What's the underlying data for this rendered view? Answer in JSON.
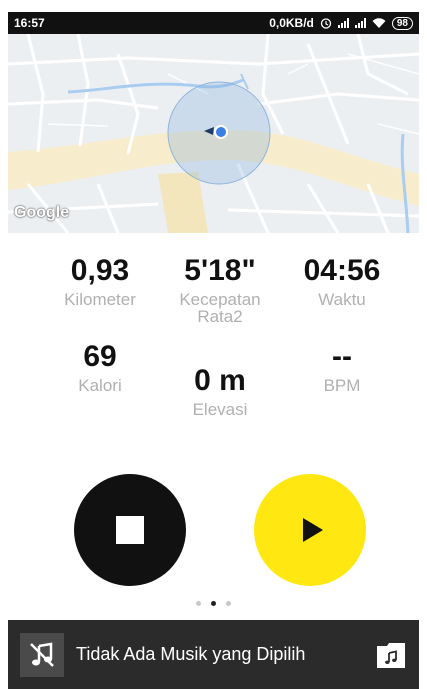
{
  "status_bar": {
    "time": "16:57",
    "network_speed": "0,0KB/d",
    "battery": "98",
    "network_type": "4G"
  },
  "map": {
    "attribution": "Google"
  },
  "stats": {
    "distance": {
      "value": "0,93",
      "label": "Kilometer"
    },
    "pace": {
      "value": "5'18\"",
      "label_line1": "Kecepatan",
      "label_line2": "Rata2"
    },
    "time": {
      "value": "04:56",
      "label": "Waktu"
    },
    "calories": {
      "value": "69",
      "label": "Kalori"
    },
    "elevation": {
      "value": "0 m",
      "label": "Elevasi"
    },
    "heart_rate": {
      "value": "--",
      "label": "BPM"
    }
  },
  "controls": {
    "stop_icon": "stop-icon",
    "play_icon": "play-icon",
    "stop_color": "#111111",
    "play_color": "#ffe812"
  },
  "pager": {
    "count": 3,
    "active": 1
  },
  "music": {
    "text": "Tidak Ada Musik yang Dipilih",
    "no_music_icon": "music-off-icon",
    "folder_icon": "music-folder-icon"
  }
}
